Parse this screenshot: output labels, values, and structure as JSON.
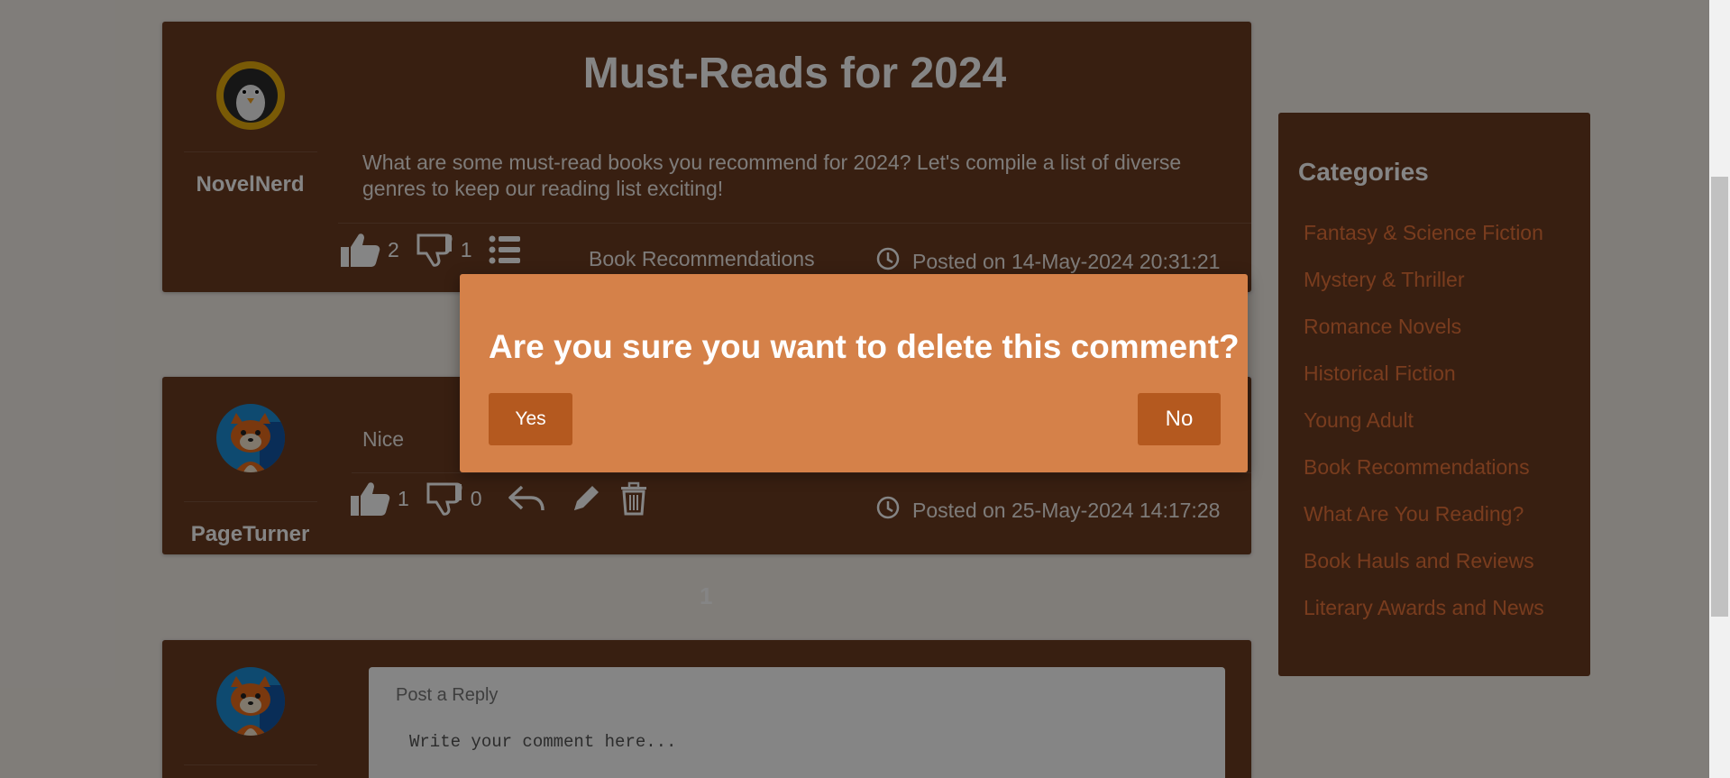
{
  "post": {
    "title": "Must-Reads for 2024",
    "author": "NovelNerd",
    "body": "What are some must-read books you recommend for 2024? Let's compile a list of diverse genres to keep our reading list exciting!",
    "likes": "2",
    "dislikes": "1",
    "category": "Book Recommendations",
    "posted": "Posted on 14-May-2024 20:31:21"
  },
  "comment": {
    "author": "PageTurner",
    "text": "Nice",
    "likes": "1",
    "dislikes": "0",
    "posted": "Posted on 25-May-2024 14:17:28"
  },
  "pagination": {
    "current": "1"
  },
  "reply": {
    "label": "Post a Reply",
    "placeholder": "Write your comment here..."
  },
  "sidebar": {
    "title": "Categories",
    "items": [
      "Fantasy & Science Fiction",
      "Mystery & Thriller",
      "Romance Novels",
      "Historical Fiction",
      "Young Adult",
      "Book Recommendations",
      "What Are You Reading?",
      "Book Hauls and Reviews",
      "Literary Awards and News"
    ]
  },
  "modal": {
    "message": "Are you sure you want to delete this comment?",
    "yes_label": "Yes",
    "no_label": "No"
  },
  "icons": {
    "like": "thumbs-up-icon",
    "dislike": "thumbs-down-icon",
    "list": "list-icon",
    "clock": "clock-icon",
    "reply": "reply-icon",
    "edit": "pencil-icon",
    "delete": "trash-icon"
  },
  "colors": {
    "card": "#6b3d22",
    "modal": "#d58149",
    "button": "#b4591f",
    "link": "#e8733a"
  }
}
